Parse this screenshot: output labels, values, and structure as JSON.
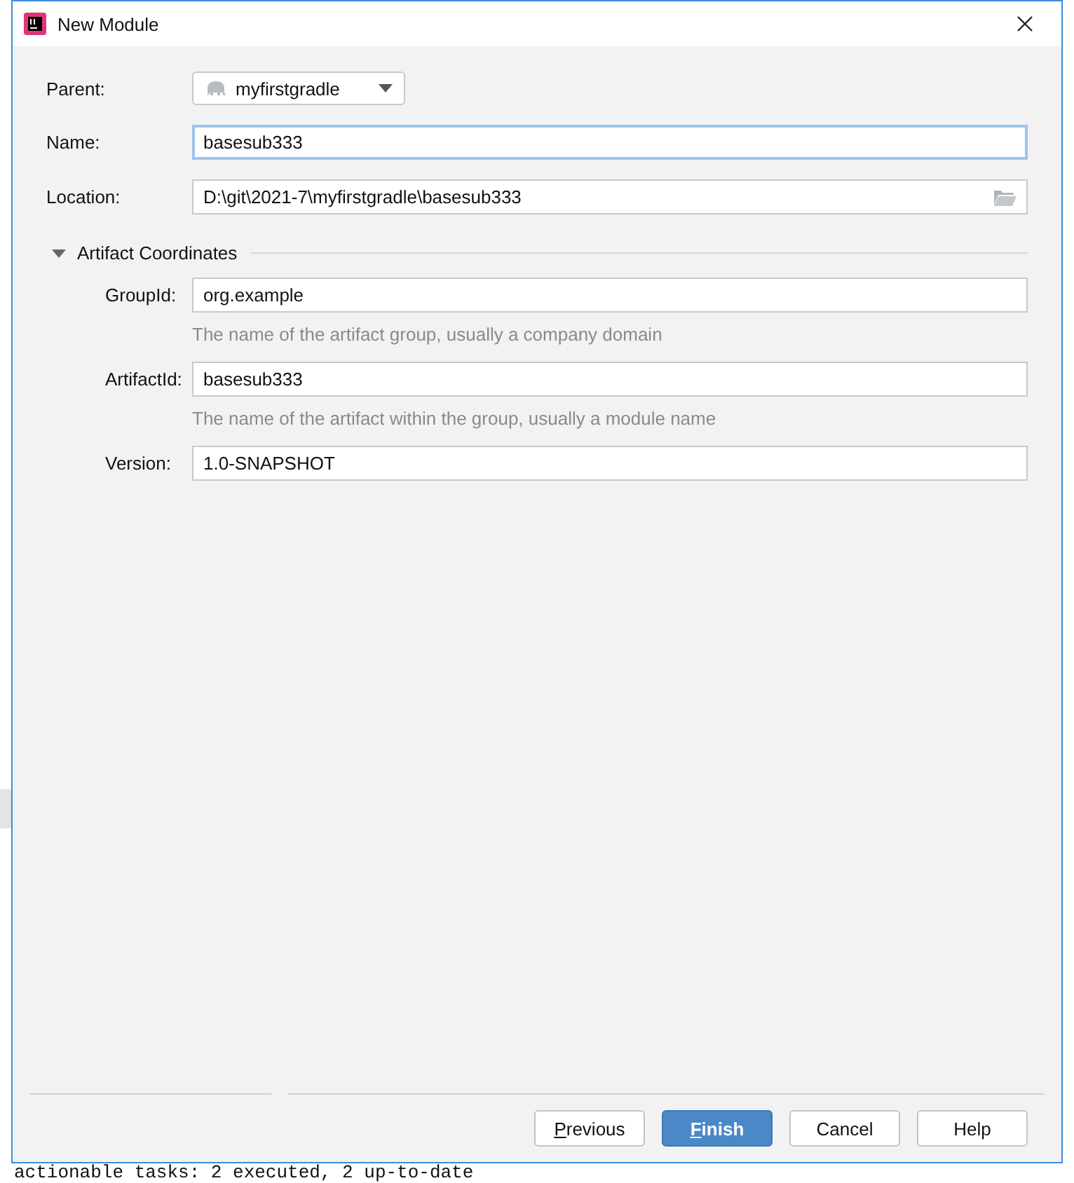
{
  "window": {
    "title": "New Module"
  },
  "parent": {
    "label": "Parent:",
    "value": "myfirstgradle"
  },
  "name": {
    "label": "Name:",
    "value": "basesub333",
    "focused": true
  },
  "location": {
    "label": "Location:",
    "value": "D:\\git\\2021-7\\myfirstgradle\\basesub333"
  },
  "artifact_coordinates": {
    "title": "Artifact Coordinates",
    "expanded": true,
    "fields": [
      {
        "label": "GroupId:",
        "value": "org.example",
        "hint": "The name of the artifact group, usually a company domain"
      },
      {
        "label": "ArtifactId:",
        "value": "basesub333",
        "hint": "The name of the artifact within the group, usually a module name"
      },
      {
        "label": "Version:",
        "value": "1.0-SNAPSHOT"
      }
    ]
  },
  "buttons": [
    {
      "mnemonic": "P",
      "label": "revious",
      "primary": false
    },
    {
      "mnemonic": "F",
      "label": "inish",
      "primary": true
    },
    {
      "label": "Cancel",
      "primary": false
    },
    {
      "label": "Help",
      "primary": false
    }
  ],
  "console": {
    "line": "actionable tasks: 2 executed, 2 up-to-date"
  }
}
